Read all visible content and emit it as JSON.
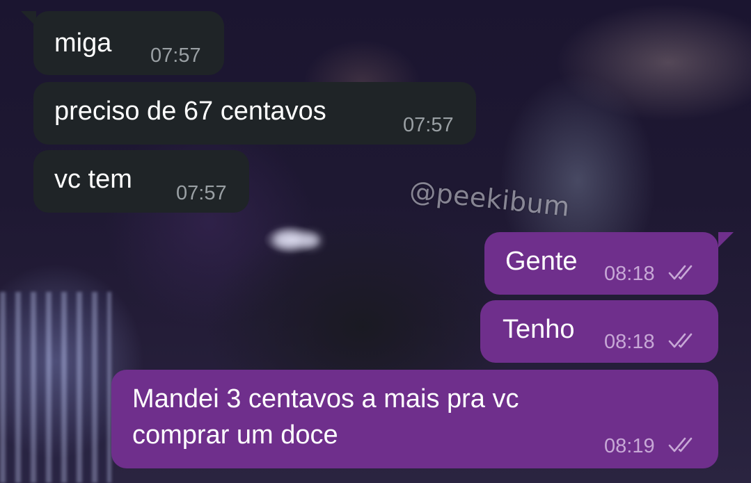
{
  "watermark": "@peekibum",
  "messages": [
    {
      "direction": "incoming",
      "text": "miga",
      "time": "07:57"
    },
    {
      "direction": "incoming",
      "text": "preciso de 67 centavos",
      "time": "07:57"
    },
    {
      "direction": "incoming",
      "text": "vc tem",
      "time": "07:57"
    },
    {
      "direction": "outgoing",
      "text": "Gente",
      "time": "08:18",
      "status": "read-double-check-icon"
    },
    {
      "direction": "outgoing",
      "text": "Tenho",
      "time": "08:18",
      "status": "read-double-check-icon"
    },
    {
      "direction": "outgoing",
      "text": "Mandei 3 centavos a mais pra vc\ncomprar um doce",
      "time": "08:19",
      "status": "read-double-check-icon"
    }
  ],
  "colors": {
    "incoming_bubble": "#1f2427",
    "outgoing_bubble": "#6f2f8c",
    "incoming_time": "#9aa0a4",
    "outgoing_time": "#c7a8d6"
  }
}
